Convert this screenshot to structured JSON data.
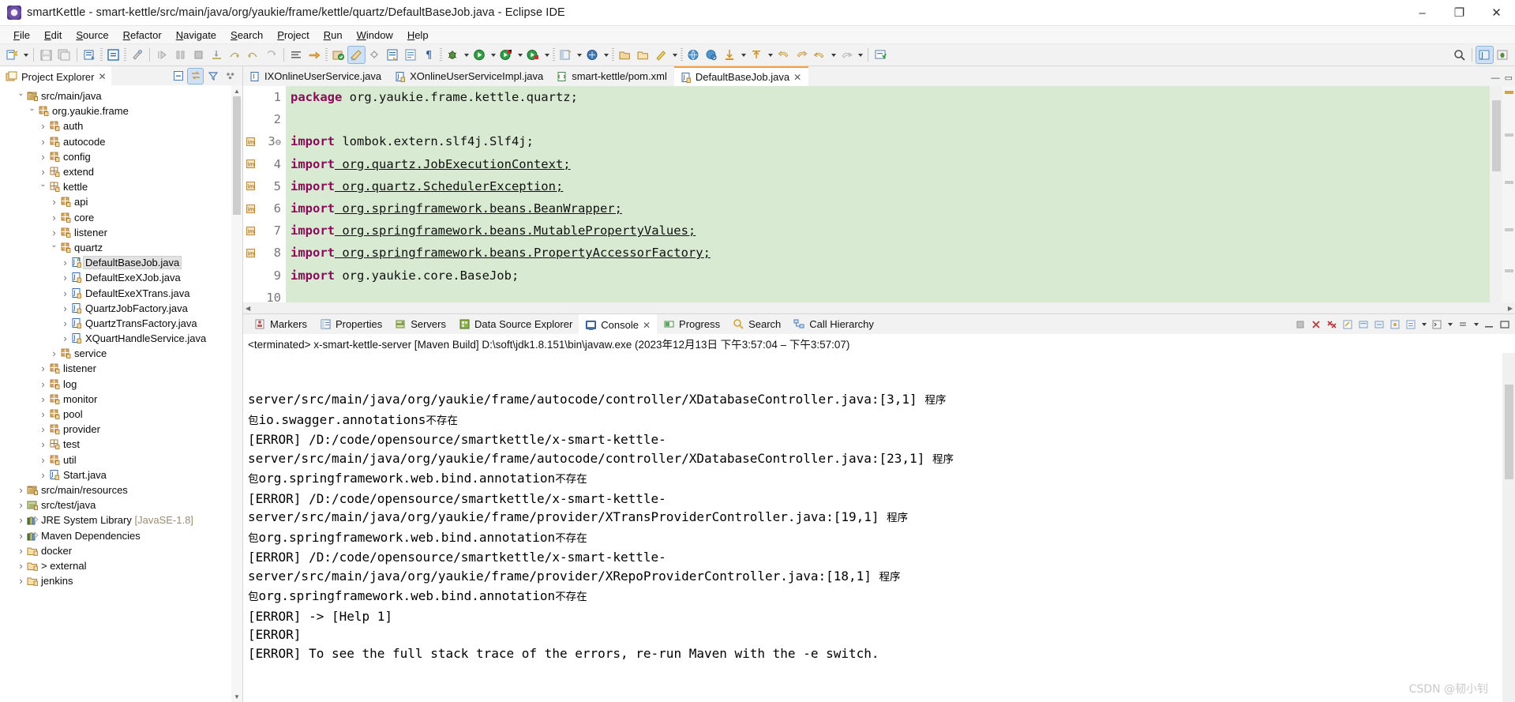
{
  "window": {
    "title": "smartKettle - smart-kettle/src/main/java/org/yaukie/frame/kettle/quartz/DefaultBaseJob.java - Eclipse IDE",
    "app_icon": "eclipse-icon",
    "minimize": "–",
    "maximize": "❐",
    "close": "✕"
  },
  "menubar": {
    "items": [
      {
        "label": "File"
      },
      {
        "label": "Edit"
      },
      {
        "label": "Source"
      },
      {
        "label": "Refactor"
      },
      {
        "label": "Navigate"
      },
      {
        "label": "Search"
      },
      {
        "label": "Project"
      },
      {
        "label": "Run"
      },
      {
        "label": "Window"
      },
      {
        "label": "Help"
      }
    ]
  },
  "explorer": {
    "tab_label": "Project Explorer",
    "close_glyph": "✕",
    "tools": [
      "collapse-all-icon",
      "link-with-editor-icon",
      "view-filter-icon",
      "view-menu-icon"
    ],
    "tree": [
      {
        "indent": 1,
        "arrow": "down",
        "icon": "source-folder-icon",
        "label": "src/main/java"
      },
      {
        "indent": 2,
        "arrow": "down",
        "icon": "package-icon",
        "label": "org.yaukie.frame"
      },
      {
        "indent": 3,
        "arrow": "right",
        "icon": "package-icon",
        "label": "auth"
      },
      {
        "indent": 3,
        "arrow": "right",
        "icon": "package-icon",
        "label": "autocode"
      },
      {
        "indent": 3,
        "arrow": "right",
        "icon": "package-icon",
        "label": "config"
      },
      {
        "indent": 3,
        "arrow": "right",
        "icon": "package-empty-icon",
        "label": "extend"
      },
      {
        "indent": 3,
        "arrow": "down",
        "icon": "package-empty-icon",
        "label": "kettle"
      },
      {
        "indent": 4,
        "arrow": "right",
        "icon": "package-icon",
        "label": "api"
      },
      {
        "indent": 4,
        "arrow": "right",
        "icon": "package-icon",
        "label": "core"
      },
      {
        "indent": 4,
        "arrow": "right",
        "icon": "package-icon",
        "label": "listener"
      },
      {
        "indent": 4,
        "arrow": "down",
        "icon": "package-icon",
        "label": "quartz"
      },
      {
        "indent": 5,
        "arrow": "right",
        "icon": "java-abstract-file-icon",
        "label": "DefaultBaseJob.java",
        "selected": true
      },
      {
        "indent": 5,
        "arrow": "right",
        "icon": "java-file-icon",
        "label": "DefaultExeXJob.java"
      },
      {
        "indent": 5,
        "arrow": "right",
        "icon": "java-file-icon",
        "label": "DefaultExeXTrans.java"
      },
      {
        "indent": 5,
        "arrow": "right",
        "icon": "java-file-icon",
        "label": "QuartzJobFactory.java"
      },
      {
        "indent": 5,
        "arrow": "right",
        "icon": "java-file-icon",
        "label": "QuartzTransFactory.java"
      },
      {
        "indent": 5,
        "arrow": "right",
        "icon": "java-file-icon",
        "label": "XQuartHandleService.java"
      },
      {
        "indent": 4,
        "arrow": "right",
        "icon": "package-icon",
        "label": "service"
      },
      {
        "indent": 3,
        "arrow": "right",
        "icon": "package-icon",
        "label": "listener"
      },
      {
        "indent": 3,
        "arrow": "right",
        "icon": "package-icon",
        "label": "log"
      },
      {
        "indent": 3,
        "arrow": "right",
        "icon": "package-icon",
        "label": "monitor"
      },
      {
        "indent": 3,
        "arrow": "right",
        "icon": "package-icon",
        "label": "pool"
      },
      {
        "indent": 3,
        "arrow": "right",
        "icon": "package-icon",
        "label": "provider"
      },
      {
        "indent": 3,
        "arrow": "right",
        "icon": "package-empty-icon",
        "label": "test"
      },
      {
        "indent": 3,
        "arrow": "right",
        "icon": "package-icon",
        "label": "util"
      },
      {
        "indent": 3,
        "arrow": "right",
        "icon": "java-file-icon",
        "label": "Start.java"
      },
      {
        "indent": 1,
        "arrow": "right",
        "icon": "source-folder-icon",
        "label": "src/main/resources"
      },
      {
        "indent": 1,
        "arrow": "right",
        "icon": "source-folder-test-icon",
        "label": "src/test/java"
      },
      {
        "indent": 1,
        "arrow": "right",
        "icon": "library-icon",
        "label": "JRE System Library",
        "suffix": " [JavaSE-1.8]"
      },
      {
        "indent": 1,
        "arrow": "right",
        "icon": "library-icon",
        "label": "Maven Dependencies"
      },
      {
        "indent": 1,
        "arrow": "right",
        "icon": "folder-icon",
        "label": "docker"
      },
      {
        "indent": 1,
        "arrow": "right",
        "icon": "folder-icon",
        "label": "> external"
      },
      {
        "indent": 1,
        "arrow": "right",
        "icon": "folder-icon",
        "label": "jenkins"
      }
    ]
  },
  "editor": {
    "tabs": [
      {
        "label": "IXOnlineUserService.java",
        "icon": "java-interface-icon",
        "active": false,
        "dirty": false
      },
      {
        "label": "XOnlineUserServiceImpl.java",
        "icon": "java-file-icon",
        "active": false,
        "dirty": false
      },
      {
        "label": "smart-kettle/pom.xml",
        "icon": "xml-file-icon",
        "active": false,
        "dirty": false
      },
      {
        "label": "DefaultBaseJob.java",
        "icon": "java-file-icon",
        "active": true,
        "dirty": false,
        "close_glyph": "✕"
      }
    ],
    "maximize_glyph": "▭",
    "minimize_glyph": "—",
    "lines": [
      {
        "num": "1",
        "mark": "",
        "fold": false,
        "parts": [
          {
            "t": "package",
            "c": "kw"
          },
          {
            "t": " org.yaukie.frame.kettle.quartz;",
            "c": "pl"
          }
        ]
      },
      {
        "num": "2",
        "mark": "",
        "fold": false,
        "parts": []
      },
      {
        "num": "3",
        "mark": "import-marker",
        "fold": true,
        "parts": [
          {
            "t": "import",
            "c": "kw"
          },
          {
            "t": " lombok.extern.slf4j.Slf4j;",
            "c": "pl"
          }
        ]
      },
      {
        "num": "4",
        "mark": "import-marker",
        "fold": false,
        "parts": [
          {
            "t": "import",
            "c": "kw"
          },
          {
            "t": " org.quartz",
            "c": "pl lnk"
          },
          {
            "t": ".JobExecutionContext;",
            "c": "pl lnk"
          }
        ]
      },
      {
        "num": "5",
        "mark": "import-marker",
        "fold": false,
        "parts": [
          {
            "t": "import",
            "c": "kw"
          },
          {
            "t": " org.quartz.SchedulerException;",
            "c": "pl lnk"
          }
        ]
      },
      {
        "num": "6",
        "mark": "import-marker",
        "fold": false,
        "parts": [
          {
            "t": "import",
            "c": "kw"
          },
          {
            "t": " org.springframework.beans.BeanWrapper;",
            "c": "pl lnk"
          }
        ]
      },
      {
        "num": "7",
        "mark": "import-marker",
        "fold": false,
        "parts": [
          {
            "t": "import",
            "c": "kw"
          },
          {
            "t": " org.springframework.beans.MutablePropertyValues;",
            "c": "pl lnk"
          }
        ]
      },
      {
        "num": "8",
        "mark": "import-marker",
        "fold": false,
        "parts": [
          {
            "t": "import",
            "c": "kw"
          },
          {
            "t": " org.springframework.beans.PropertyAccessorFactory;",
            "c": "pl lnk"
          }
        ]
      },
      {
        "num": "9",
        "mark": "",
        "fold": false,
        "parts": [
          {
            "t": "import",
            "c": "kw"
          },
          {
            "t": " org.yaukie.core.BaseJob;",
            "c": "pl"
          }
        ]
      },
      {
        "num": "10",
        "mark": "",
        "fold": false,
        "parts": []
      }
    ]
  },
  "console": {
    "tabs": [
      {
        "label": "Markers",
        "icon": "markers-icon",
        "active": false
      },
      {
        "label": "Properties",
        "icon": "properties-icon",
        "active": false
      },
      {
        "label": "Servers",
        "icon": "servers-icon",
        "active": false
      },
      {
        "label": "Data Source Explorer",
        "icon": "data-source-icon",
        "active": false
      },
      {
        "label": "Console",
        "icon": "console-icon",
        "active": true,
        "close_glyph": "✕"
      },
      {
        "label": "Progress",
        "icon": "progress-icon",
        "active": false
      },
      {
        "label": "Search",
        "icon": "search-icon",
        "active": false
      },
      {
        "label": "Call Hierarchy",
        "icon": "call-hierarchy-icon",
        "active": false
      }
    ],
    "toolbar_icons": [
      "terminate-icon",
      "remove-launch-icon",
      "remove-all-terminated-icon",
      "clear-console-icon",
      "scroll-lock-icon",
      "word-wrap-icon",
      "pin-console-icon",
      "display-selected-console-icon",
      "open-console-icon",
      "view-menu-icon",
      "minimize-icon",
      "maximize-icon"
    ],
    "status_line": "<terminated> x-smart-kettle-server [Maven Build] D:\\soft\\jdk1.8.151\\bin\\javaw.exe  (2023年12月13日 下午3:57:04 – 下午3:57:07)",
    "output": "server/src/main/java/org/yaukie/frame/autocode/controller/XDatabaseController.java:[3,1] 程序\n包io.swagger.annotations不存在\n[ERROR] /D:/code/opensource/smartkettle/x-smart-kettle-\nserver/src/main/java/org/yaukie/frame/autocode/controller/XDatabaseController.java:[23,1] 程序\n包org.springframework.web.bind.annotation不存在\n[ERROR] /D:/code/opensource/smartkettle/x-smart-kettle-\nserver/src/main/java/org/yaukie/frame/provider/XTransProviderController.java:[19,1] 程序\n包org.springframework.web.bind.annotation不存在\n[ERROR] /D:/code/opensource/smartkettle/x-smart-kettle-\nserver/src/main/java/org/yaukie/frame/provider/XRepoProviderController.java:[18,1] 程序\n包org.springframework.web.bind.annotation不存在\n[ERROR] -> [Help 1]\n[ERROR]\n[ERROR] To see the full stack trace of the errors, re-run Maven with the -e switch."
  },
  "watermark": "CSDN @韧小钊",
  "colors": {
    "code_background": "#d8ead2",
    "keyword": "#8b0a5c",
    "active_tab_accent": "#ff9e2e",
    "selection": "#e2e2e2"
  }
}
